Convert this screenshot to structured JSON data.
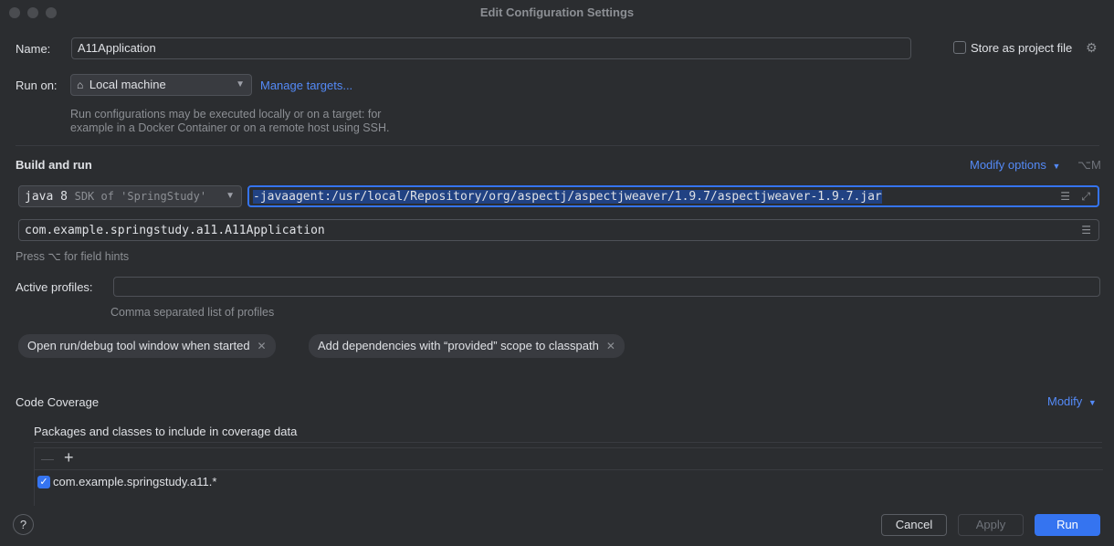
{
  "window": {
    "title": "Edit Configuration Settings"
  },
  "name_row": {
    "label": "Name:",
    "value": "A11Application",
    "store_label": "Store as project file"
  },
  "run_on": {
    "label": "Run on:",
    "selected": "Local machine",
    "manage_link": "Manage targets...",
    "hint_line1": "Run configurations may be executed locally or on a target: for",
    "hint_line2": "example in a Docker Container or on a remote host using SSH."
  },
  "build_and_run": {
    "heading": "Build and run",
    "modify_options": "Modify options",
    "shortcut": "⌥M",
    "jdk_name": "java 8",
    "jdk_detail": "SDK of 'SpringStudy'",
    "vm_options": "-javaagent:/usr/local/Repository/org/aspectj/aspectjweaver/1.9.7/aspectjweaver-1.9.7.jar",
    "main_class": "com.example.springstudy.a11.A11Application",
    "field_hint": "Press ⌥ for field hints"
  },
  "active_profiles": {
    "label": "Active profiles:",
    "value": "",
    "hint": "Comma separated list of profiles"
  },
  "chips": [
    {
      "label": "Open run/debug tool window when started"
    },
    {
      "label": "Add dependencies with “provided” scope to classpath"
    }
  ],
  "coverage": {
    "heading": "Code Coverage",
    "modify": "Modify",
    "packages_label": "Packages and classes to include in coverage data",
    "items": [
      {
        "label": "com.example.springstudy.a11.*",
        "checked": true
      }
    ]
  },
  "footer": {
    "help": "?",
    "cancel": "Cancel",
    "apply": "Apply",
    "run": "Run"
  },
  "colors": {
    "accent": "#3574f0",
    "link": "#548af7",
    "background": "#2b2d30"
  }
}
